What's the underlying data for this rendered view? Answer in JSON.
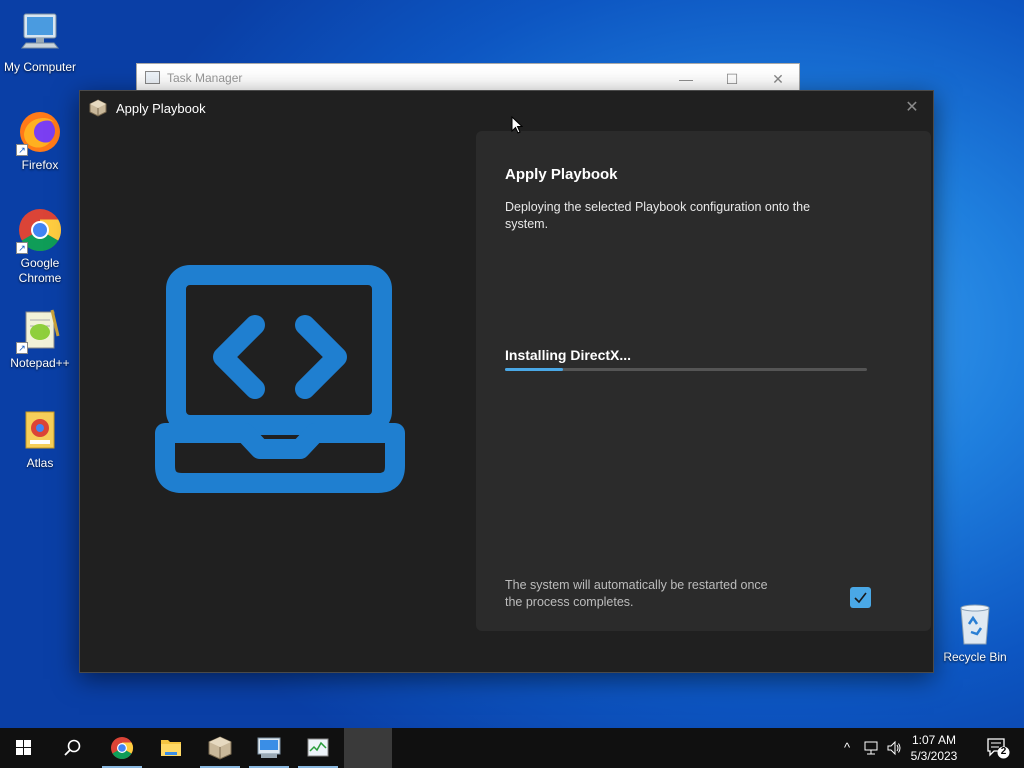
{
  "desktop": {
    "icons": [
      {
        "label": "My Computer"
      },
      {
        "label": "Firefox"
      },
      {
        "label": "Google Chrome"
      },
      {
        "label": "Notepad++"
      },
      {
        "label": "Atlas"
      },
      {
        "label": "Recycle Bin"
      }
    ]
  },
  "task_manager": {
    "title": "Task Manager",
    "minimize": "—",
    "maximize": "☐",
    "close": "✕"
  },
  "apply_playbook": {
    "window_title": "Apply Playbook",
    "close": "✕",
    "heading": "Apply Playbook",
    "description": "Deploying the selected Playbook configuration onto the system.",
    "progress_label": "Installing DirectX...",
    "progress_fraction": 0.16,
    "restart_note": "The system will automatically be restarted once the process completes.",
    "restart_checked": true,
    "accent_color": "#4aa8e6",
    "art_color": "#1f7fd0"
  },
  "taskbar": {
    "time": "1:07 AM",
    "date": "5/3/2023",
    "notification_count": "2",
    "tray_chevron": "^"
  }
}
